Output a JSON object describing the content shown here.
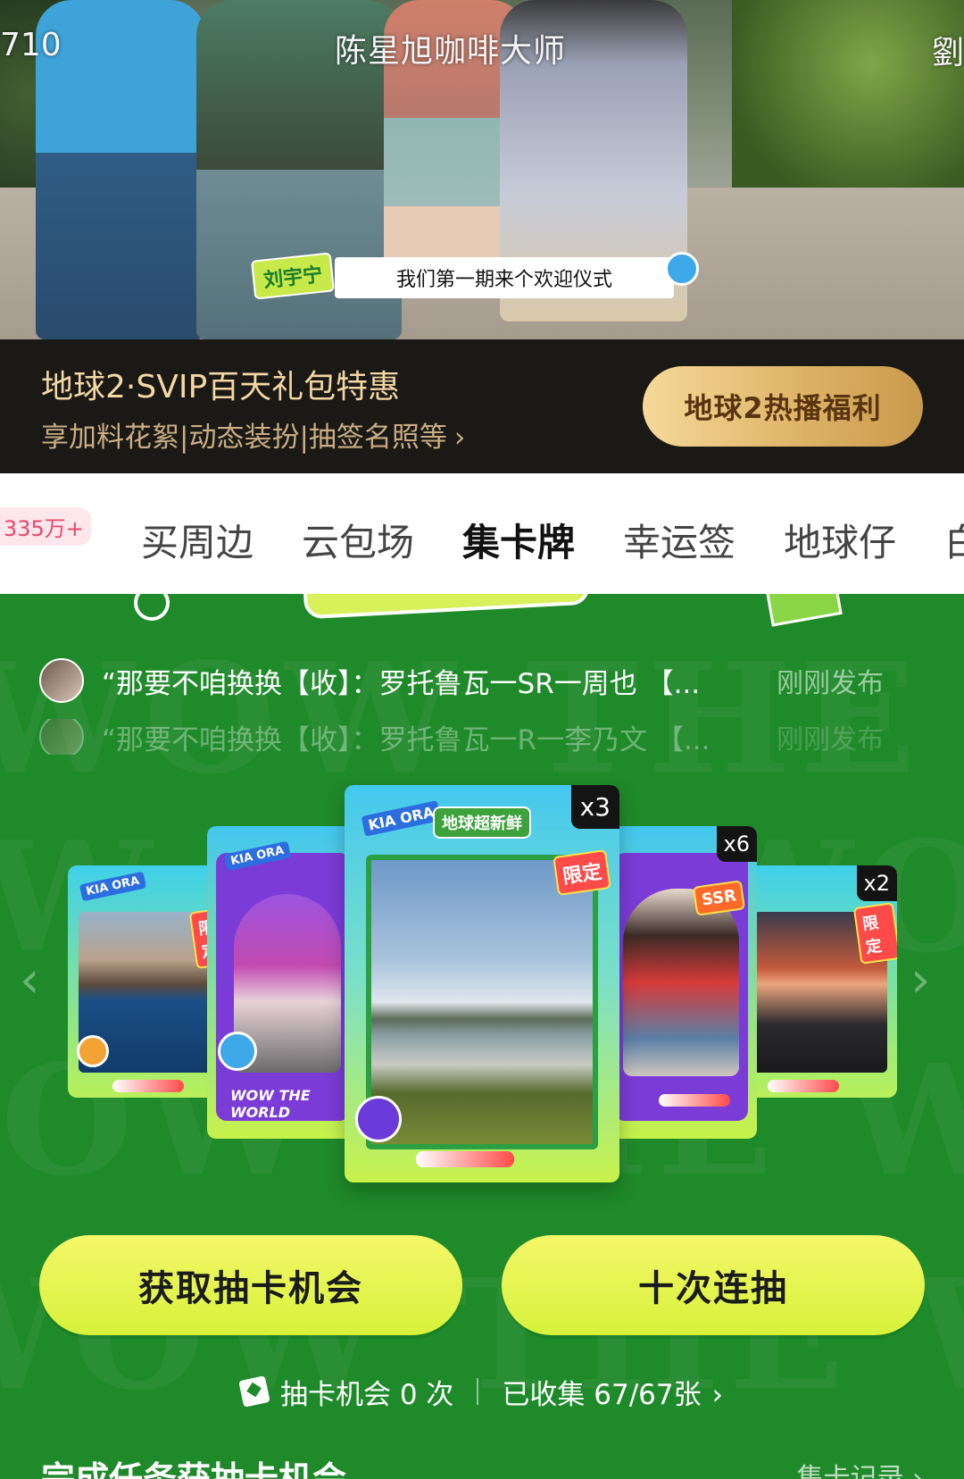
{
  "video": {
    "title": "陈星旭咖啡大师",
    "left_tag": "710",
    "right_tag": "劉",
    "speaker": "刘宇宁",
    "subtitle": "我们第一期来个欢迎仪式"
  },
  "promo": {
    "title": "地球2·SVIP百天礼包特惠",
    "subtitle": "享加料花絮|动态装扮|抽签名照等",
    "chevron": "›",
    "button_label": "地球2热播福利",
    "colors": {
      "background": "#1b1916",
      "button": "#dcb163"
    }
  },
  "tabs": {
    "count_badge": "335万+",
    "items": [
      {
        "label": "买周边",
        "active": false
      },
      {
        "label": "云包场",
        "active": false
      },
      {
        "label": "集卡牌",
        "active": true
      },
      {
        "label": "幸运签",
        "active": false
      },
      {
        "label": "地球仔",
        "active": false
      },
      {
        "label": "白",
        "active": false
      }
    ]
  },
  "feed": [
    {
      "text": "“那要不咱换换【收】：罗托鲁瓦一SR一周也 【...",
      "time": "刚刚发布"
    },
    {
      "text": "“那要不咱换换【收】：罗托鲁瓦一R一李乃文 【...",
      "time": "刚刚发布"
    }
  ],
  "cards": {
    "logo_text": "地球超新鲜",
    "kiaora": "KIA ORA",
    "wow": "WOW THE WORLD",
    "center": {
      "count": "x3",
      "tag": "限定"
    },
    "right1": {
      "count": "x6",
      "tag": "SSR"
    },
    "right2": {
      "count": "x2",
      "tag": "限定"
    },
    "left2": {
      "tag": "限定"
    },
    "nav_prev": "‹",
    "nav_next": "›"
  },
  "actions": {
    "get_chance": "获取抽卡机会",
    "ten_draws": "十次连抽"
  },
  "stats": {
    "chances": "抽卡机会 0 次",
    "collected": "已收集 67/67张",
    "chevron": "›"
  },
  "bottom": {
    "title": "完成任务获抽卡机会",
    "link": "集卡记录 ›"
  },
  "watermark": "WOW THE WORLD",
  "colors": {
    "green": "#1f8a2a",
    "action_button": "#e6f44c"
  }
}
